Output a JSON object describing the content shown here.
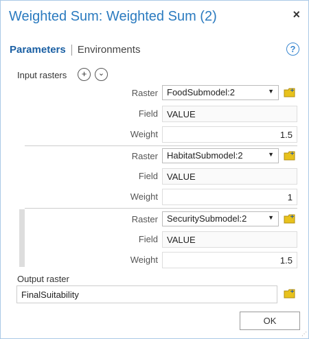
{
  "dialog": {
    "title": "Weighted Sum: Weighted Sum (2)",
    "close_icon": "×"
  },
  "tabs": {
    "parameters": "Parameters",
    "environments": "Environments",
    "help": "?"
  },
  "input_rasters": {
    "label": "Input rasters",
    "add_symbol": "+",
    "expand_symbol": "⌄",
    "rows": [
      {
        "raster_label": "Raster",
        "raster": "FoodSubmodel:2",
        "field_label": "Field",
        "field": "VALUE",
        "weight_label": "Weight",
        "weight": "1.5"
      },
      {
        "raster_label": "Raster",
        "raster": "HabitatSubmodel:2",
        "field_label": "Field",
        "field": "VALUE",
        "weight_label": "Weight",
        "weight": "1"
      },
      {
        "raster_label": "Raster",
        "raster": "SecuritySubmodel:2",
        "field_label": "Field",
        "field": "VALUE",
        "weight_label": "Weight",
        "weight": "1.5"
      }
    ]
  },
  "output": {
    "label": "Output raster",
    "value": "FinalSuitability"
  },
  "buttons": {
    "ok": "OK"
  },
  "colors": {
    "title": "#2a7abf",
    "tab_active": "#1a5fa3",
    "folder_yellow": "#e8c21c"
  }
}
